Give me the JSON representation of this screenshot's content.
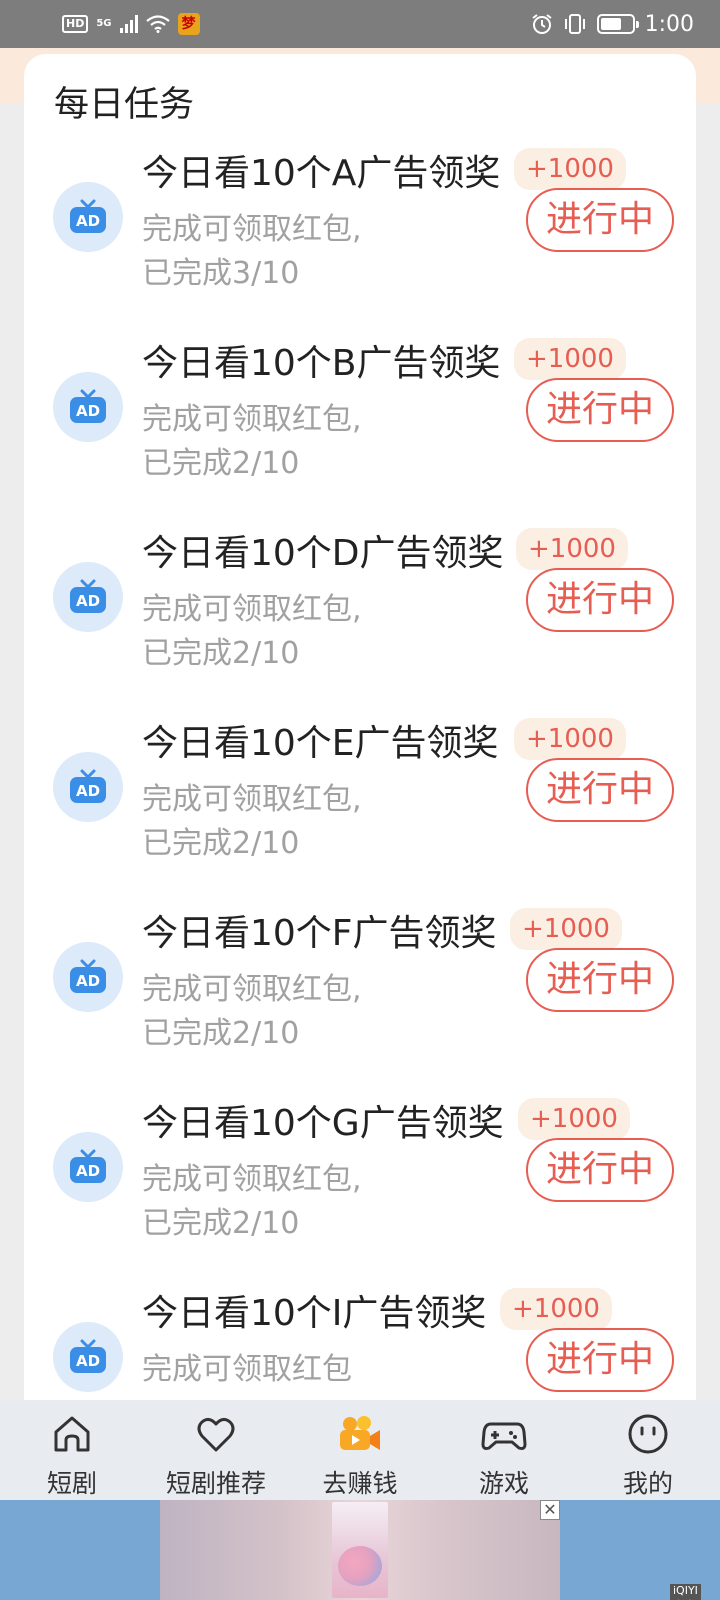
{
  "status_bar": {
    "hd_label": "HD",
    "network_label": "5G",
    "app_badge": "梦",
    "time": "1:00"
  },
  "card": {
    "title": "每日任务"
  },
  "tasks": [
    {
      "title": "今日看10个A广告领奖",
      "reward": "+1000",
      "desc_line1": "完成可领取红包,",
      "desc_line2": "已完成3/10",
      "status": "进行中"
    },
    {
      "title": "今日看10个B广告领奖",
      "reward": "+1000",
      "desc_line1": "完成可领取红包,",
      "desc_line2": "已完成2/10",
      "status": "进行中"
    },
    {
      "title": "今日看10个D广告领奖",
      "reward": "+1000",
      "desc_line1": "完成可领取红包,",
      "desc_line2": "已完成2/10",
      "status": "进行中"
    },
    {
      "title": "今日看10个E广告领奖",
      "reward": "+1000",
      "desc_line1": "完成可领取红包,",
      "desc_line2": "已完成2/10",
      "status": "进行中"
    },
    {
      "title": "今日看10个F广告领奖",
      "reward": "+1000",
      "desc_line1": "完成可领取红包,",
      "desc_line2": "已完成2/10",
      "status": "进行中"
    },
    {
      "title": "今日看10个G广告领奖",
      "reward": "+1000",
      "desc_line1": "完成可领取红包,",
      "desc_line2": "已完成2/10",
      "status": "进行中"
    },
    {
      "title": "今日看10个I广告领奖",
      "reward": "+1000",
      "desc_line1": "完成可领取红包",
      "desc_line2": "",
      "status": "进行中"
    }
  ],
  "ad_icon_label": "AD",
  "tab_bar": {
    "items": [
      {
        "label": "短剧",
        "icon": "home-icon"
      },
      {
        "label": "短剧推荐",
        "icon": "heart-icon"
      },
      {
        "label": "去赚钱",
        "icon": "video-camera-icon",
        "active": true
      },
      {
        "label": "游戏",
        "icon": "gamepad-icon"
      },
      {
        "label": "我的",
        "icon": "face-icon"
      }
    ]
  },
  "ad_banner": {
    "brand": "iQIYI广告",
    "close_glyph": "✕"
  },
  "colors": {
    "accent": "#e65d52",
    "reward_bg": "#fbeee3",
    "icon_bg": "#dceafa",
    "icon_blue": "#3a8ee6",
    "status_bar_bg": "#7d7d7d",
    "tab_bar_bg": "#e8ecf0",
    "ad_bg": "#79a7d3"
  }
}
